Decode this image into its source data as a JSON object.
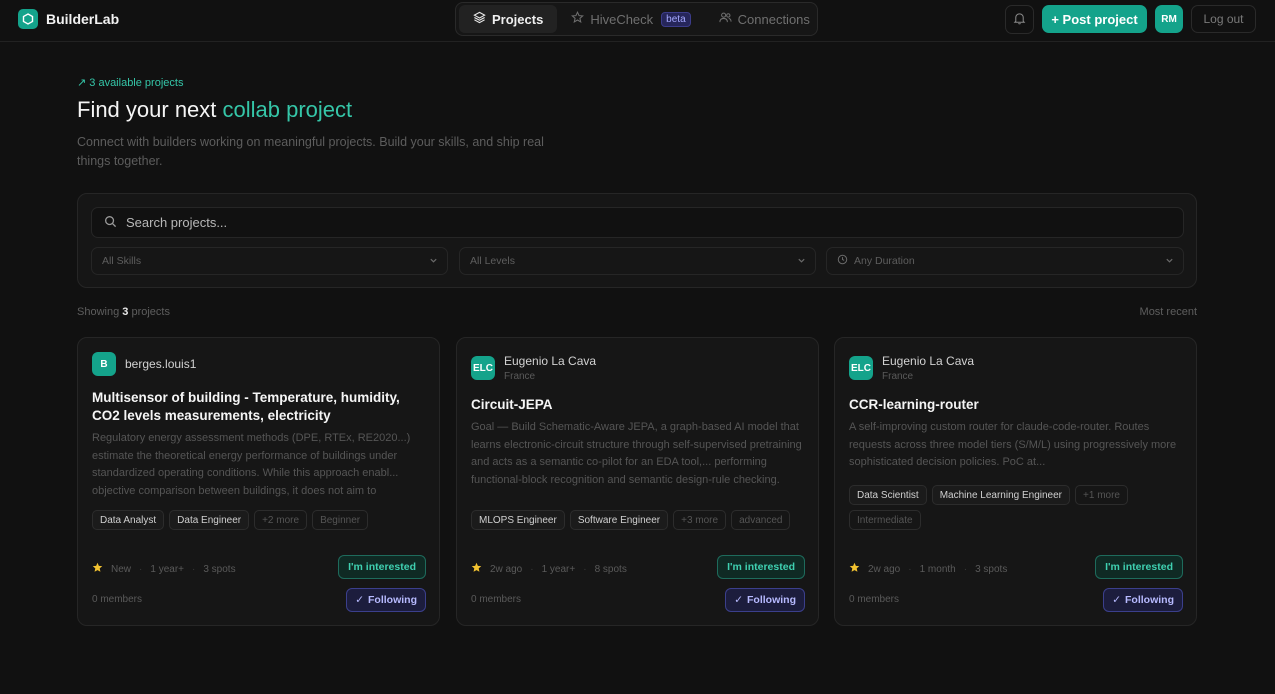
{
  "app": {
    "name": "BuilderLab"
  },
  "nav": {
    "tabs": [
      {
        "label": "Projects",
        "icon": "layers-icon",
        "active": true
      },
      {
        "label": "HiveCheck",
        "icon": "star-icon",
        "badge": "beta"
      },
      {
        "label": "Connections",
        "icon": "users-icon"
      }
    ]
  },
  "header": {
    "post_label": "+ Post project",
    "avatar_initials": "RM",
    "logout_label": "Log out"
  },
  "hero": {
    "available": "↗ 3 available projects",
    "title_prefix": "Find your next ",
    "title_accent": "collab project",
    "subtitle": "Connect with builders working on meaningful projects. Build your skills, and ship real things together."
  },
  "filters": {
    "search_placeholder": "Search projects...",
    "skills": "All Skills",
    "levels": "All Levels",
    "duration": "Any Duration"
  },
  "results": {
    "showing_prefix": "Showing ",
    "count": "3",
    "showing_suffix": " projects",
    "sort": "Most recent"
  },
  "colors": {
    "accent": "#14a38b",
    "accent_text": "#35c6a8",
    "following": "#b7baff"
  },
  "projects": [
    {
      "avatar": "B",
      "owner": "berges.louis1",
      "location": "",
      "title": "Multisensor of building - Temperature, humidity, CO2 levels measurements, electricity",
      "description": "Regulatory energy assessment methods (DPE, RTEx, RE2020...) estimate the theoretical energy performance of buildings under standardized operating conditions. While this approach enabl... objective comparison between buildings, it does not aim to",
      "tags": [
        "Data Analyst",
        "Data Engineer",
        "+2 more",
        "Beginner"
      ],
      "status": "New",
      "duration": "1 year+",
      "spots": "3 spots",
      "interested_label": "I'm interested",
      "members": "0 members",
      "following_label": "Following"
    },
    {
      "avatar": "ELC",
      "owner": "Eugenio La Cava",
      "location": "France",
      "title": "Circuit-JEPA",
      "description": "Goal — Build Schematic-Aware JEPA, a graph-based AI model that learns electronic-circuit structure through self-supervised pretraining and acts as a semantic co-pilot for an EDA tool,... performing functional-block recognition and semantic design-rule checking. Components — Five layers: data sourcing",
      "tags": [
        "MLOPS Engineer",
        "Software Engineer",
        "+3 more",
        "advanced"
      ],
      "status": "2w ago",
      "duration": "1 year+",
      "spots": "8 spots",
      "interested_label": "I'm interested",
      "members": "0 members",
      "following_label": "Following"
    },
    {
      "avatar": "ELC",
      "owner": "Eugenio La Cava",
      "location": "France",
      "title": "CCR-learning-router",
      "description": "A self-improving custom router for claude-code-router. Routes requests across three model tiers (S/M/L) using progressively more sophisticated decision policies. PoC at...",
      "tags": [
        "Data Scientist",
        "Machine Learning Engineer",
        "+1 more",
        "Intermediate"
      ],
      "status": "2w ago",
      "duration": "1 month",
      "spots": "3 spots",
      "interested_label": "I'm interested",
      "members": "0 members",
      "following_label": "Following"
    }
  ]
}
